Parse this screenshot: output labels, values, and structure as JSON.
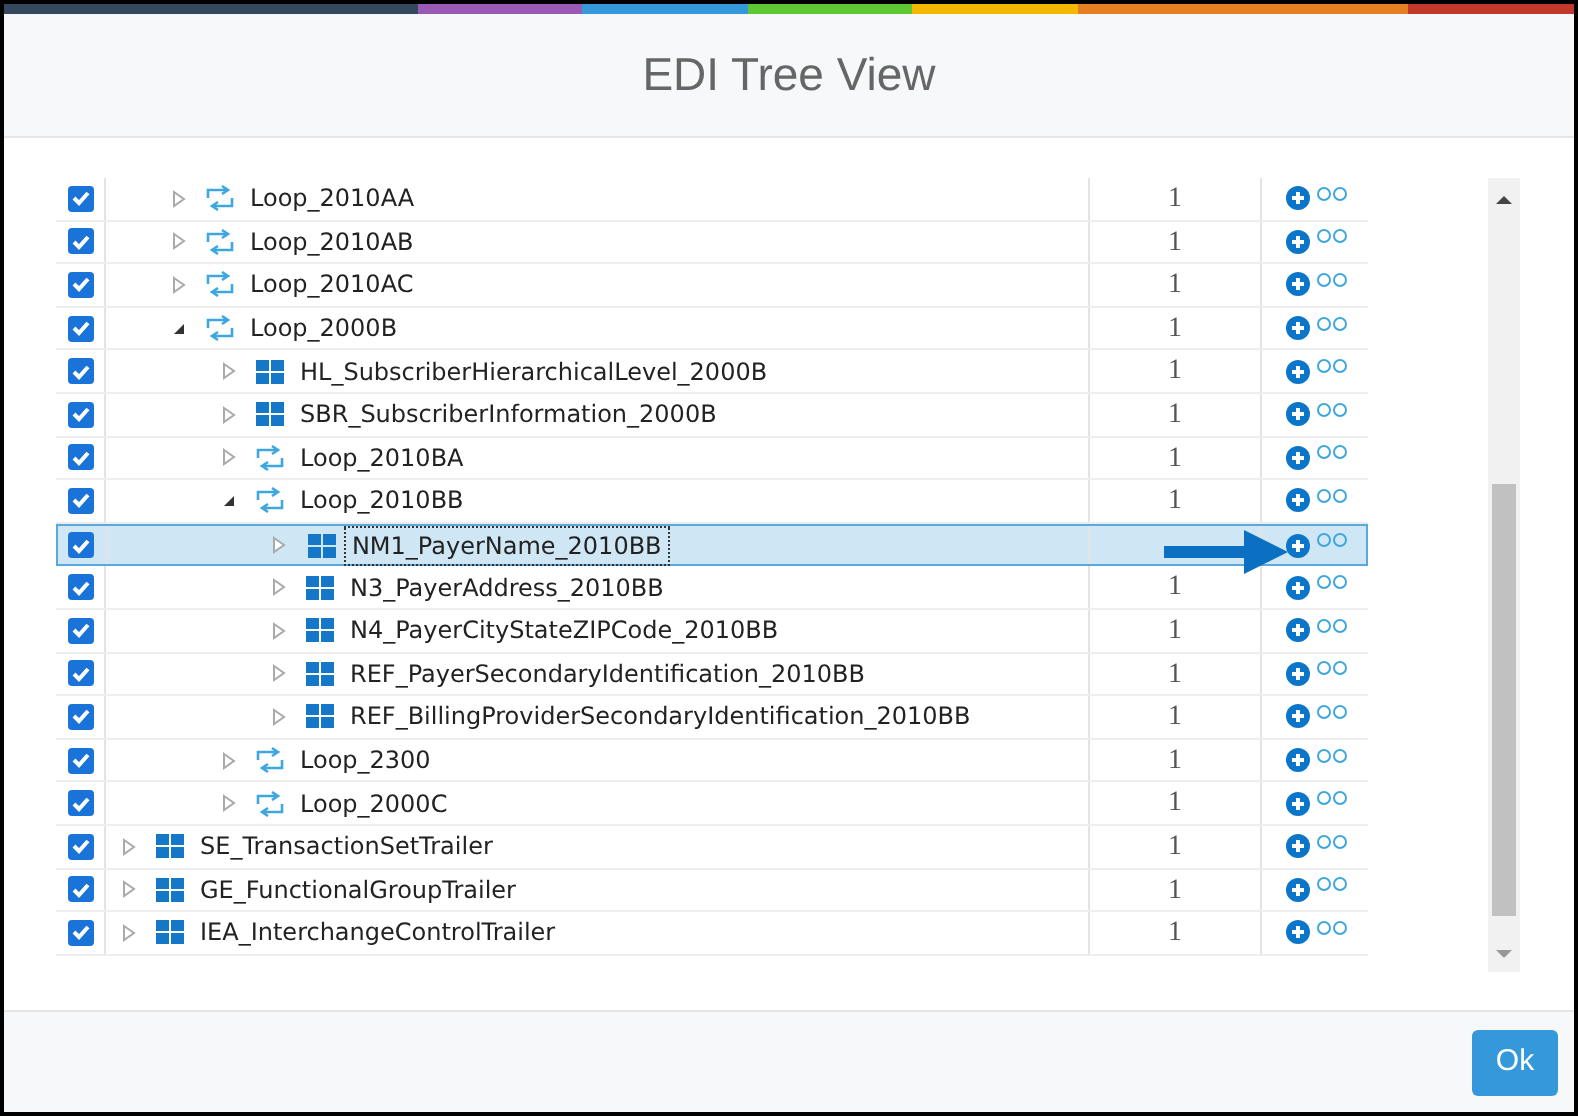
{
  "dialog": {
    "title": "EDI Tree View"
  },
  "tree": [
    {
      "children": [
        {
          "kind": "loop",
          "label": "Loop_2010AA",
          "count": "1",
          "checked": true,
          "expanded": false,
          "selected": false
        },
        {
          "kind": "loop",
          "label": "Loop_2010AB",
          "count": "1",
          "checked": true,
          "expanded": false,
          "selected": false
        },
        {
          "kind": "loop",
          "label": "Loop_2010AC",
          "count": "1",
          "checked": true,
          "expanded": false,
          "selected": false
        },
        {
          "kind": "loop",
          "label": "Loop_2000B",
          "count": "1",
          "checked": true,
          "expanded": true,
          "selected": false,
          "children": [
            {
              "kind": "segment",
              "label": "HL_SubscriberHierarchicalLevel_2000B",
              "count": "1",
              "checked": true,
              "expanded": false,
              "selected": false
            },
            {
              "kind": "segment",
              "label": "SBR_SubscriberInformation_2000B",
              "count": "1",
              "checked": true,
              "expanded": false,
              "selected": false
            },
            {
              "kind": "loop",
              "label": "Loop_2010BA",
              "count": "1",
              "checked": true,
              "expanded": false,
              "selected": false
            },
            {
              "kind": "loop",
              "label": "Loop_2010BB",
              "count": "1",
              "checked": true,
              "expanded": true,
              "selected": false,
              "children": [
                {
                  "kind": "segment",
                  "label": "NM1_PayerName_2010BB",
                  "checked": true,
                  "expanded": false,
                  "selected": true
                },
                {
                  "kind": "segment",
                  "label": "N3_PayerAddress_2010BB",
                  "count": "1",
                  "checked": true,
                  "expanded": false,
                  "selected": false
                },
                {
                  "kind": "segment",
                  "label": "N4_PayerCityStateZIPCode_2010BB",
                  "count": "1",
                  "checked": true,
                  "expanded": false,
                  "selected": false
                },
                {
                  "kind": "segment",
                  "label": "REF_PayerSecondaryIdentification_2010BB",
                  "count": "1",
                  "checked": true,
                  "expanded": false,
                  "selected": false
                },
                {
                  "kind": "segment",
                  "label": "REF_BillingProviderSecondaryIdentification_2010BB",
                  "count": "1",
                  "checked": true,
                  "expanded": false,
                  "selected": false
                }
              ]
            },
            {
              "kind": "loop",
              "label": "Loop_2300",
              "count": "1",
              "checked": true,
              "expanded": false,
              "selected": false
            },
            {
              "kind": "loop",
              "label": "Loop_2000C",
              "count": "1",
              "checked": true,
              "expanded": false,
              "selected": false
            }
          ]
        }
      ]
    },
    {
      "kind": "segment",
      "label": "SE_TransactionSetTrailer",
      "count": "1",
      "checked": true,
      "expanded": false,
      "selected": false
    },
    {
      "kind": "segment",
      "label": "GE_FunctionalGroupTrailer",
      "count": "1",
      "checked": true,
      "expanded": false,
      "selected": false
    },
    {
      "kind": "segment",
      "label": "IEA_InterchangeControlTrailer",
      "count": "1",
      "checked": true,
      "expanded": false,
      "selected": false
    }
  ],
  "ok_button": "Ok"
}
